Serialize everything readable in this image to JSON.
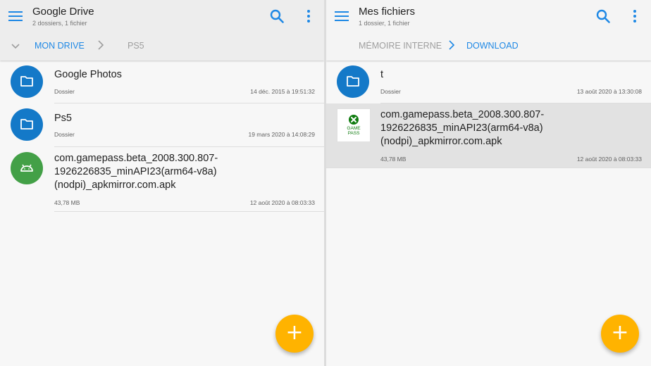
{
  "left": {
    "title": "Google Drive",
    "subtitle": "2 dossiers, 1 fichier",
    "breadcrumbs": [
      "MON DRIVE",
      "PS5"
    ],
    "items": [
      {
        "name": "Google Photos",
        "meta": "Dossier",
        "date": "14 déc. 2015 à 19:51:32",
        "icon": "folder-icon"
      },
      {
        "name": "Ps5",
        "meta": "Dossier",
        "date": "19 mars 2020 à 14:08:29",
        "icon": "folder-icon"
      },
      {
        "name_lines": [
          "com.gamepass.beta_2008.300.807-",
          "1926226835_minAPI23(arm64-v8a)",
          "(nodpi)_apkmirror.com.apk"
        ],
        "meta": "43,78 MB",
        "date": "12 août 2020 à 08:03:33",
        "icon": "android-icon"
      }
    ]
  },
  "right": {
    "title": "Mes fichiers",
    "subtitle": "1 dossier, 1 fichier",
    "breadcrumbs": [
      "MÉMOIRE INTERNE",
      "DOWNLOAD"
    ],
    "items": [
      {
        "name": "t",
        "meta": "Dossier",
        "date": "13 août 2020 à 13:30:08",
        "icon": "folder-icon"
      },
      {
        "name_lines": [
          "com.gamepass.beta_2008.300.807-",
          "1926226835_minAPI23(arm64-v8a)",
          "(nodpi)_apkmirror.com.apk"
        ],
        "meta": "43,78 MB",
        "date": "12 août 2020 à 08:03:33",
        "icon": "game-pass-icon",
        "thumb_lines": [
          "GAME",
          "PASS"
        ]
      }
    ]
  },
  "fab_symbol": "+",
  "colors": {
    "accent": "#1e88e5",
    "folder": "#1479c8",
    "android": "#43a047",
    "fab": "#ffb300",
    "xbox": "#107c10"
  }
}
